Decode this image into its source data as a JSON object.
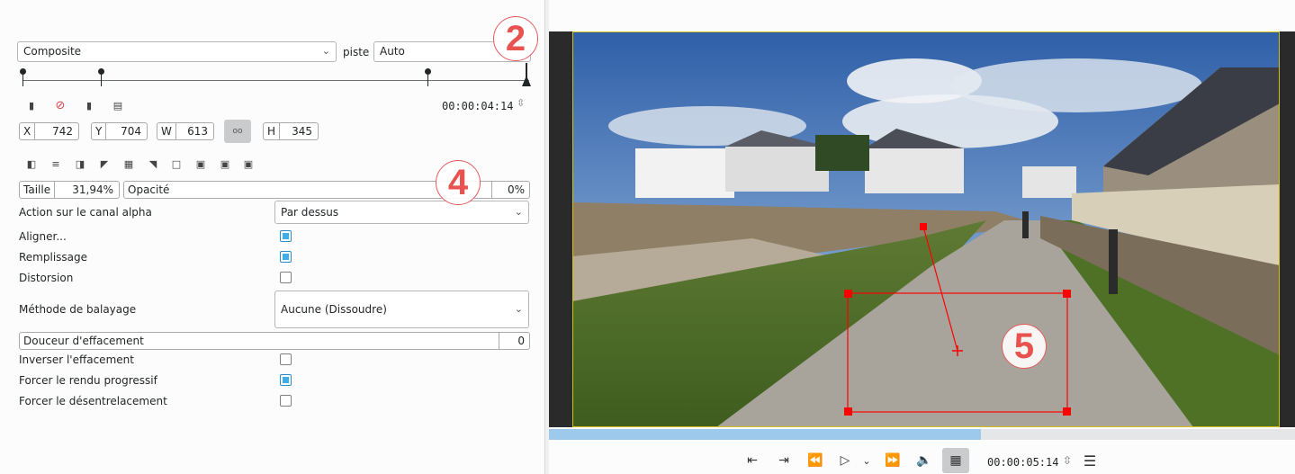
{
  "effect": {
    "composite_label": "Composite",
    "track_label": "piste",
    "track_value": "Auto"
  },
  "keyframes": {
    "timecode": "00:00:04:14"
  },
  "geometry": {
    "x_label": "X",
    "x_value": "742",
    "y_label": "Y",
    "y_value": "704",
    "w_label": "W",
    "w_value": "613",
    "h_label": "H",
    "h_value": "345",
    "link_label": "oo"
  },
  "size": {
    "label": "Taille",
    "value": "31,94%"
  },
  "opacity": {
    "label": "Opacité",
    "value": "0%"
  },
  "alpha": {
    "label": "Action sur le canal alpha",
    "value": "Par dessus"
  },
  "options": {
    "align_label": "Aligner...",
    "align_checked": true,
    "fill_label": "Remplissage",
    "fill_checked": true,
    "distort_label": "Distorsion",
    "distort_checked": false
  },
  "wipe": {
    "label": "Méthode de balayage",
    "value": "Aucune (Dissoudre)"
  },
  "softness": {
    "label": "Douceur d'effacement",
    "value": "0"
  },
  "flags": {
    "invert_label": "Inverser l'effacement",
    "invert_checked": false,
    "progressive_label": "Forcer le rendu progressif",
    "progressive_checked": true,
    "deinterlace_label": "Forcer le désentrelacement",
    "deinterlace_checked": false
  },
  "annotations": {
    "marker_2": "2",
    "marker_4": "4",
    "marker_5": "5"
  },
  "monitor": {
    "timecode": "00:00:05:14"
  },
  "colors": {
    "accent": "#3daee9",
    "frame_red": "#ff0000",
    "marker": "#e8524f"
  }
}
